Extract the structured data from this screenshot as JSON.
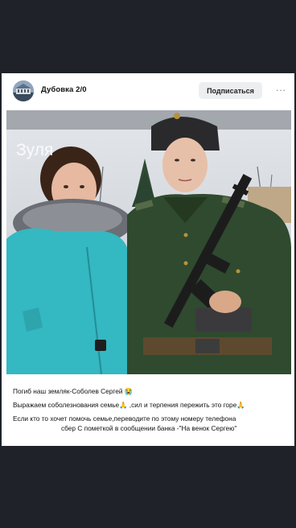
{
  "post": {
    "group_name": "Дубовка 2/0",
    "subscribe_label": "Подписаться",
    "more_label": "···",
    "photo_caption": "Зуля",
    "text_lines": [
      "Погиб наш земляк-Соболев Сергей 😭",
      "Выражаем соболезнования семье🙏 ,сил и терпения пережить это горе🙏",
      "Если кто то хочет помочь семье,переводите по этому номеру телефона",
      "сбер С пометкой в сообщении банка -\"На венок Сергею\""
    ]
  },
  "colors": {
    "background": "#1f2329",
    "card": "#ffffff",
    "button_bg": "#eceff2",
    "jacket": "#34b8c2",
    "uniform": "#2f4a2e"
  },
  "icons": {
    "avatar": "group-avatar-building",
    "more": "more-horizontal-icon",
    "crying": "crying-face-emoji",
    "praying": "praying-hands-emoji"
  }
}
